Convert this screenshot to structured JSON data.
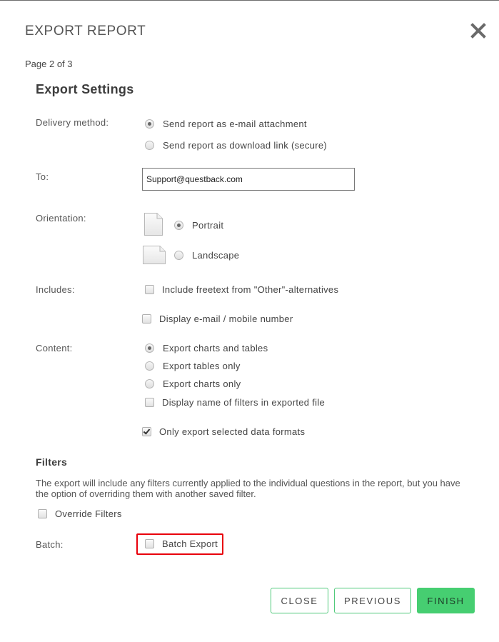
{
  "dialog": {
    "title": "EXPORT REPORT",
    "close_icon": "close-x-icon",
    "page_indicator": "Page 2 of 3"
  },
  "settings": {
    "heading": "Export Settings",
    "delivery": {
      "label": "Delivery method:",
      "options": [
        {
          "label": "Send report as e-mail attachment",
          "selected": true
        },
        {
          "label": "Send report as download link (secure)",
          "selected": false
        }
      ]
    },
    "to": {
      "label": "To:",
      "value": "Support@questback.com"
    },
    "orientation": {
      "label": "Orientation:",
      "options": [
        {
          "label": "Portrait",
          "selected": true,
          "icon": "portrait-page-icon"
        },
        {
          "label": "Landscape",
          "selected": false,
          "icon": "landscape-page-icon"
        }
      ]
    },
    "includes": {
      "label": "Includes:",
      "options": [
        {
          "label": "Include freetext from \"Other\"-alternatives",
          "checked": false
        },
        {
          "label": "Display e-mail / mobile number",
          "checked": false
        }
      ]
    },
    "content": {
      "label": "Content:",
      "radios": [
        {
          "label": "Export charts and tables",
          "selected": true
        },
        {
          "label": "Export tables only",
          "selected": false
        },
        {
          "label": "Export charts only",
          "selected": false
        }
      ],
      "checkboxes": [
        {
          "label": "Display name of filters in exported file",
          "checked": false
        },
        {
          "label": "Only export selected data formats",
          "checked": true
        }
      ]
    }
  },
  "filters": {
    "heading": "Filters",
    "description": "The export will include any filters currently applied to the individual questions in the report, but you have the option of overriding them with another saved filter.",
    "override": {
      "label": "Override Filters",
      "checked": false
    }
  },
  "batch": {
    "label": "Batch:",
    "option": {
      "label": "Batch Export",
      "checked": false
    },
    "highlight_color": "#e8000b"
  },
  "footer": {
    "close_label": "CLOSE",
    "previous_label": "PREVIOUS",
    "finish_label": "FINISH",
    "accent_color": "#46ce71"
  }
}
